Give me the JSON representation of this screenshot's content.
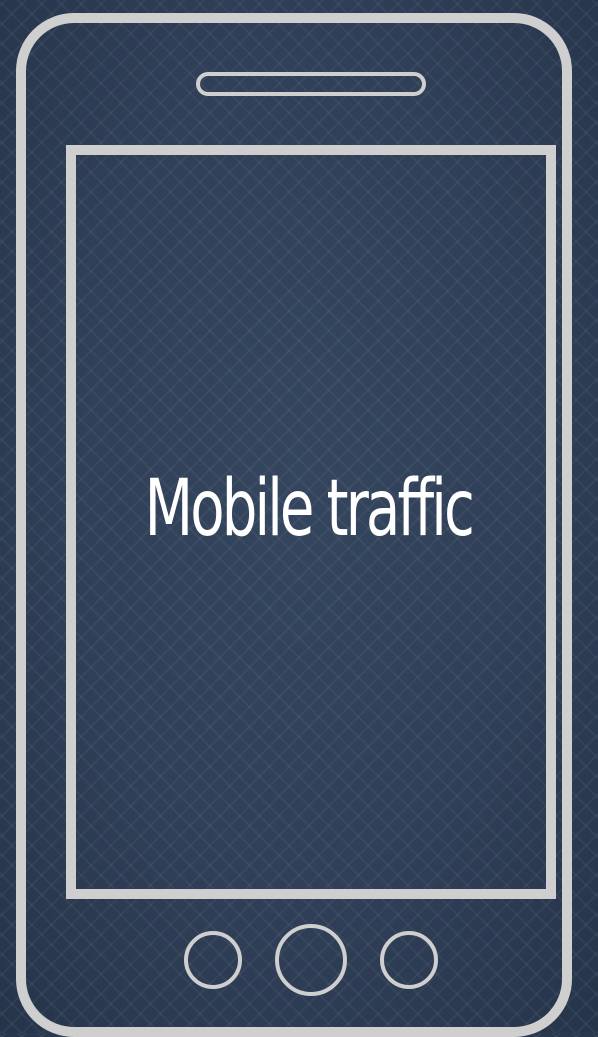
{
  "screen": {
    "title": "Mobile traffic"
  },
  "icons": {
    "device": "smartphone-icon",
    "earpiece": "speaker-slot-icon",
    "buttons": [
      "back-button-icon",
      "home-button-icon",
      "menu-button-icon"
    ]
  },
  "colors": {
    "background": "#2e3e55",
    "outline": "#cfcfcf",
    "text": "#ffffff"
  }
}
